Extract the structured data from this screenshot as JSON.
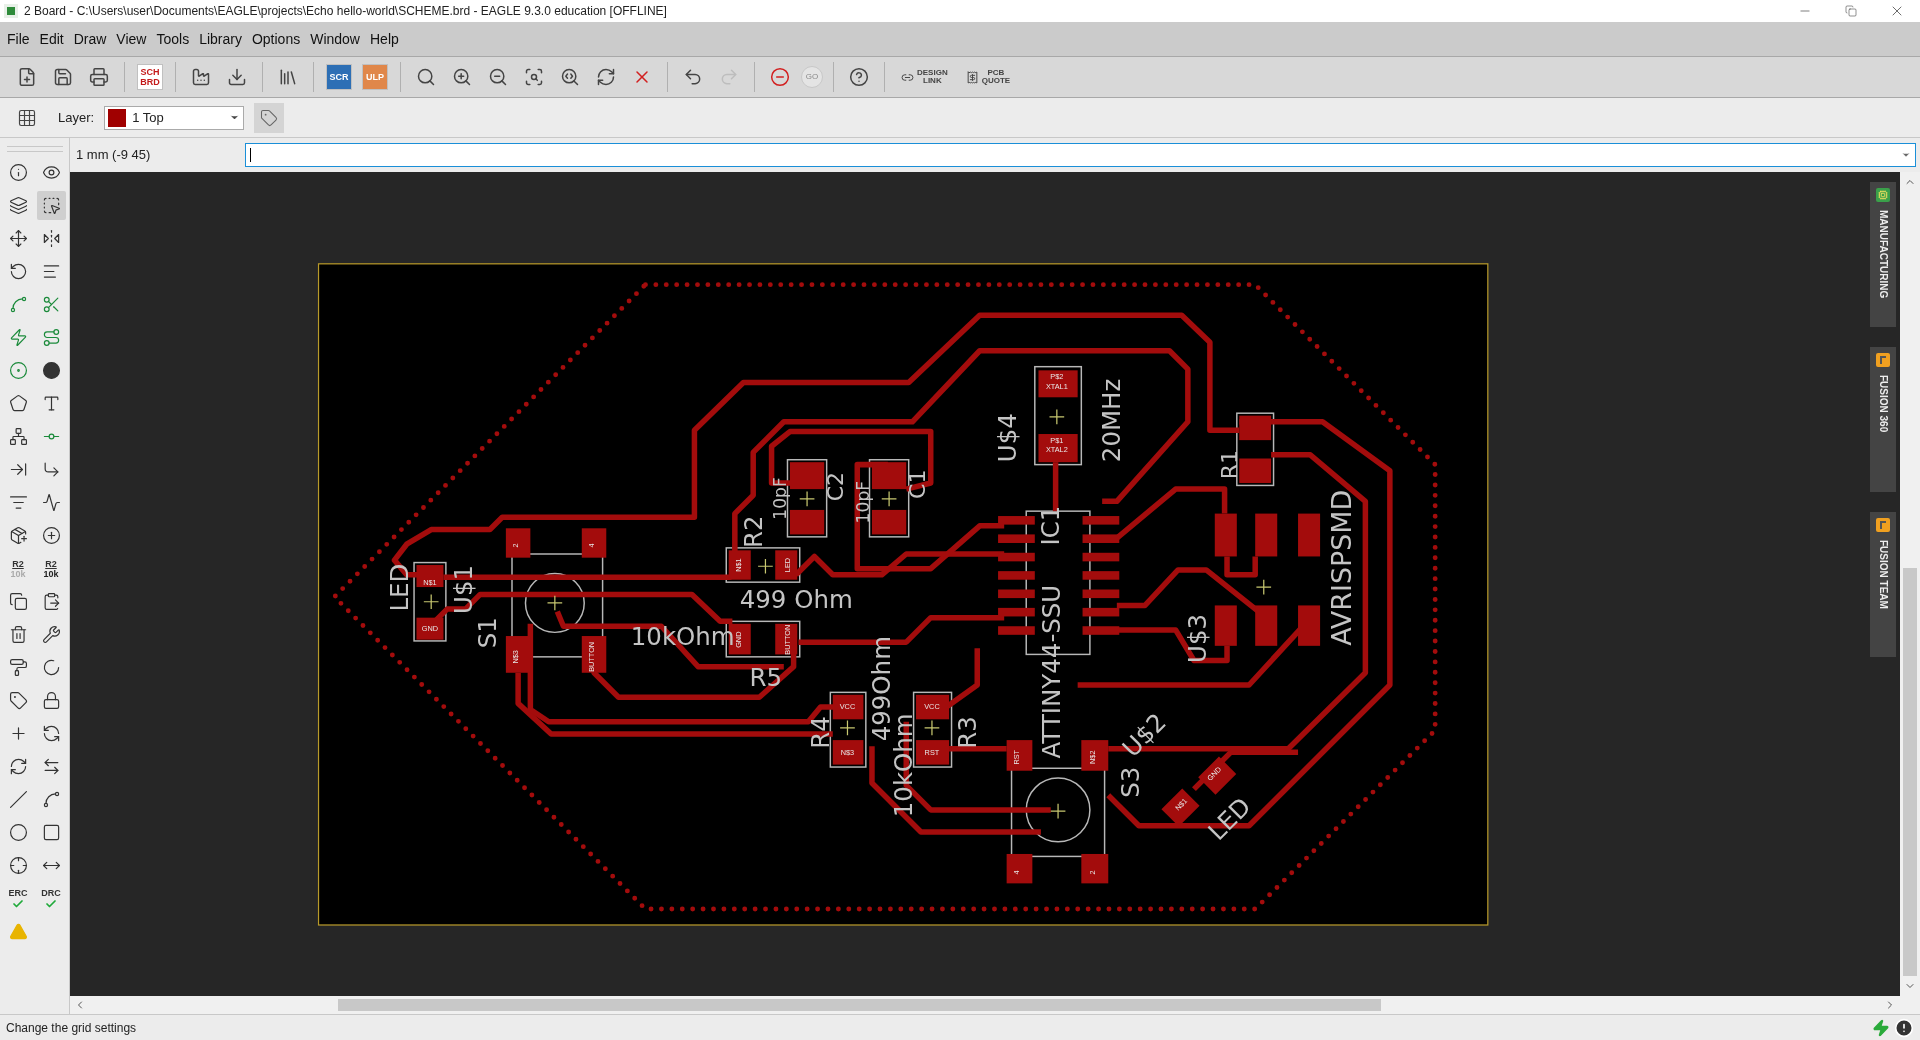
{
  "window": {
    "title": "2 Board - C:\\Users\\user\\Documents\\EAGLE\\projects\\Echo hello-world\\SCHEME.brd - EAGLE 9.3.0 education [OFFLINE]"
  },
  "menu": [
    "File",
    "Edit",
    "Draw",
    "View",
    "Tools",
    "Library",
    "Options",
    "Window",
    "Help"
  ],
  "toolbar": [
    {
      "kind": "icon",
      "disabled": false
    },
    {
      "kind": "icon",
      "disabled": false
    },
    {
      "kind": "icon",
      "disabled": false
    },
    {
      "kind": "badge",
      "label": "SCH",
      "sublabel": "BRD"
    },
    {
      "kind": "icon",
      "disabled": false
    },
    {
      "kind": "icon",
      "disabled": false
    },
    {
      "kind": "icon",
      "disabled": false
    },
    {
      "kind": "badge",
      "label": "SCR",
      "color": "#2d6fb5"
    },
    {
      "kind": "badge",
      "label": "ULP",
      "color": "#e0874a"
    },
    {
      "kind": "icon",
      "disabled": false
    },
    {
      "kind": "icon",
      "disabled": false
    },
    {
      "kind": "icon",
      "disabled": false
    },
    {
      "kind": "icon",
      "disabled": false
    },
    {
      "kind": "icon",
      "disabled": false
    },
    {
      "kind": "icon",
      "disabled": false
    },
    {
      "kind": "icon",
      "disabled": false
    },
    {
      "kind": "icon",
      "disabled": false
    },
    {
      "kind": "icon",
      "disabled": true
    },
    {
      "kind": "icon",
      "disabled": false
    },
    {
      "kind": "round",
      "label": "GO",
      "disabled": true
    },
    {
      "kind": "icon",
      "disabled": false
    },
    {
      "kind": "link",
      "label": "DESIGN",
      "sublabel": "LINK"
    },
    {
      "kind": "link",
      "label": "PCB",
      "sublabel": "QUOTE"
    }
  ],
  "layer": {
    "label": "Layer:",
    "value": "1 Top",
    "color": "#a00000"
  },
  "coordinates": "1 mm (-9 45)",
  "left_tools": [
    {
      "kind": "icon",
      "selected": false
    },
    {
      "kind": "icon",
      "selected": false
    },
    {
      "kind": "icon",
      "selected": false
    },
    {
      "kind": "icon",
      "selected": true
    },
    {
      "kind": "icon",
      "selected": false
    },
    {
      "kind": "icon",
      "selected": false
    },
    {
      "kind": "icon",
      "selected": false
    },
    {
      "kind": "icon",
      "selected": false
    },
    {
      "kind": "icon",
      "selected": false
    },
    {
      "kind": "icon",
      "selected": false
    },
    {
      "kind": "icon",
      "selected": false
    },
    {
      "kind": "icon",
      "selected": false
    },
    {
      "kind": "icon",
      "selected": false
    },
    {
      "kind": "icon",
      "selected": false
    },
    {
      "kind": "icon",
      "selected": false
    },
    {
      "kind": "icon",
      "selected": false
    },
    {
      "kind": "icon",
      "selected": false
    },
    {
      "kind": "icon",
      "selected": false
    },
    {
      "kind": "icon",
      "selected": false
    },
    {
      "kind": "icon",
      "selected": false
    },
    {
      "kind": "icon",
      "selected": false
    },
    {
      "kind": "icon",
      "selected": false
    },
    {
      "kind": "icon",
      "selected": false
    },
    {
      "kind": "icon",
      "selected": false
    },
    {
      "kind": "text",
      "label": "R2",
      "sublabel": "10k",
      "selected": false
    },
    {
      "kind": "text",
      "label": "R2",
      "sublabel": "10k",
      "selected": false
    },
    {
      "kind": "icon",
      "selected": false
    },
    {
      "kind": "icon",
      "selected": false
    },
    {
      "kind": "icon",
      "selected": false
    },
    {
      "kind": "icon",
      "selected": false
    },
    {
      "kind": "icon",
      "selected": false
    },
    {
      "kind": "icon",
      "selected": false
    },
    {
      "kind": "icon",
      "selected": false
    },
    {
      "kind": "icon",
      "selected": false
    },
    {
      "kind": "icon",
      "selected": false
    },
    {
      "kind": "icon",
      "selected": false
    },
    {
      "kind": "icon",
      "selected": false
    },
    {
      "kind": "icon",
      "selected": false
    },
    {
      "kind": "icon",
      "selected": false
    },
    {
      "kind": "icon",
      "selected": false
    },
    {
      "kind": "icon",
      "selected": false
    },
    {
      "kind": "icon",
      "selected": false
    },
    {
      "kind": "icon",
      "selected": false
    },
    {
      "kind": "icon",
      "selected": false
    },
    {
      "kind": "check",
      "label": "ERC",
      "selected": false
    },
    {
      "kind": "check",
      "label": "DRC",
      "selected": false
    },
    {
      "kind": "icon",
      "selected": false
    }
  ],
  "board": {
    "labels": [
      {
        "text": "LED"
      },
      {
        "text": "U$1"
      },
      {
        "text": "S1"
      },
      {
        "text": "R2"
      },
      {
        "text": "499 Ohm"
      },
      {
        "text": "10kOhm"
      },
      {
        "text": "R5"
      },
      {
        "text": "10pF"
      },
      {
        "text": "C2"
      },
      {
        "text": "10pF"
      },
      {
        "text": "C1"
      },
      {
        "text": "U$4"
      },
      {
        "text": "20MHz"
      },
      {
        "text": "IC1"
      },
      {
        "text": "ATTINY44-SSU"
      },
      {
        "text": "R4"
      },
      {
        "text": "499Ohm"
      },
      {
        "text": "10kOhm"
      },
      {
        "text": "R3"
      },
      {
        "text": "S3"
      },
      {
        "text": "R1"
      },
      {
        "text": "AVRISPSMD"
      },
      {
        "text": "U$3"
      },
      {
        "text": "U$2"
      },
      {
        "text": "LED"
      }
    ],
    "pad_labels": [
      {
        "text": "N$1"
      },
      {
        "text": "GND"
      },
      {
        "text": "N$1"
      },
      {
        "text": "LED"
      },
      {
        "text": "GND"
      },
      {
        "text": "BUTTON"
      },
      {
        "text": "VCC"
      },
      {
        "text": "N$3"
      },
      {
        "text": "VCC"
      },
      {
        "text": "RST"
      },
      {
        "text": "P$2"
      },
      {
        "text": "XTAL1"
      },
      {
        "text": "P$1"
      },
      {
        "text": "XTAL2"
      },
      {
        "text": "2"
      },
      {
        "text": "4"
      },
      {
        "text": "N$3"
      },
      {
        "text": "BUTTON"
      },
      {
        "text": "RST"
      },
      {
        "text": "N$2"
      },
      {
        "text": "4"
      },
      {
        "text": "2"
      },
      {
        "text": "GND"
      },
      {
        "text": "N$1"
      }
    ]
  },
  "side_tabs": [
    {
      "label": "MANUFACTURING",
      "color": "#3aa04a"
    },
    {
      "label": "FUSION 360",
      "color": "#f0a020"
    },
    {
      "label": "FUSION TEAM",
      "color": "#f0a020"
    }
  ],
  "status_bar": "Change the grid settings"
}
